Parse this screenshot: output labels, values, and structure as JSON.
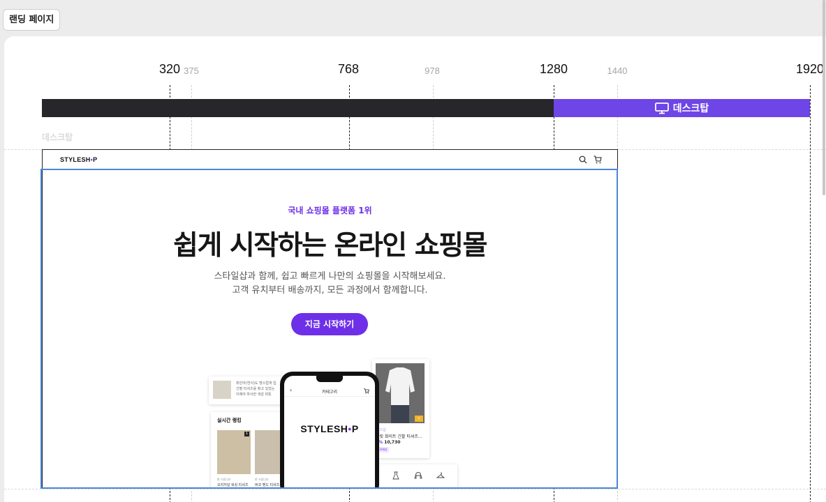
{
  "page_chip": "랜딩 페이지",
  "breakpoints": {
    "major": [
      "320",
      "768",
      "1280",
      "1920"
    ],
    "minor": [
      "375",
      "978",
      "1440"
    ]
  },
  "active_device": {
    "label": "데스크탑",
    "icon": "monitor-icon",
    "color": "#6e45e6"
  },
  "ghost_label": "데스크탑",
  "site": {
    "logo": {
      "pre": "STYLESH",
      "dot": "•",
      "post": "P"
    },
    "nav_icons": [
      "search-icon",
      "cart-icon"
    ],
    "hero": {
      "eyebrow": "국내 쇼핑몰 플랫폼 1위",
      "title": "쉽게 시작하는 온라인 쇼핑몰",
      "subtitle_line1": "스타일샵과 함께, 쉽고 빠르게 나만의 쇼핑몰을 시작해보세요.",
      "subtitle_line2": "고객 유치부터 배송까지, 모든 과정에서 함께합니다.",
      "cta": "지금 시작하기"
    },
    "ticker": {
      "line1": "최민아(연서)도 명스럽게 입",
      "line2": "긴팔 티셔츠를 찾고 있었는",
      "line3": "이제야 마사한 색감 따뜻"
    },
    "ranking": {
      "title": "실시간 랭킹",
      "items": [
        {
          "badge": "1",
          "shop": "한 스튜디오",
          "name": "오리지널 워싱 티셔츠"
        },
        {
          "badge": "",
          "shop": "한 스튜디오",
          "name": "버코 밴드 티셔츠"
        }
      ]
    },
    "product": {
      "shop": "니즈샵",
      "name": "베릿 화이트 긴팔 티셔츠...",
      "discount": "3%",
      "price": "10,730",
      "tag": "무료배송",
      "badge": "⚡"
    },
    "phone": {
      "title": "카테고리",
      "back": "‹"
    },
    "categories": [
      "hat-icon",
      "dress-icon",
      "hoodie-icon",
      "hanger-icon"
    ]
  }
}
